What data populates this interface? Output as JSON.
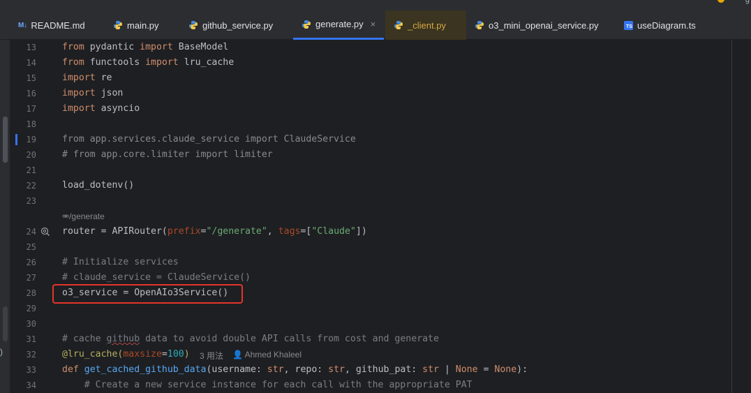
{
  "top_badge": "g",
  "tabs": [
    {
      "label": "README.md",
      "icon": "markdown-icon",
      "active": false
    },
    {
      "label": "main.py",
      "icon": "python-icon",
      "active": false
    },
    {
      "label": "github_service.py",
      "icon": "python-icon",
      "active": false
    },
    {
      "label": "generate.py",
      "icon": "python-icon",
      "active": true
    },
    {
      "label": "_client.py",
      "icon": "python-icon",
      "active": false
    },
    {
      "label": "o3_mini_openai_service.py",
      "icon": "python-icon",
      "active": false
    },
    {
      "label": "useDiagram.ts",
      "icon": "typescript-icon",
      "active": false
    }
  ],
  "close_glyph": "×",
  "left_glyph": ")",
  "line_numbers": [
    "13",
    "14",
    "15",
    "16",
    "17",
    "18",
    "19",
    "20",
    "21",
    "22",
    "23",
    "24",
    "25",
    "26",
    "27",
    "28",
    "29",
    "30",
    "31",
    "32",
    "33",
    "34"
  ],
  "code": {
    "l13": {
      "kw1": "from",
      "mod": " pydantic ",
      "kw2": "import",
      "name": " BaseModel"
    },
    "l14": {
      "kw1": "from",
      "mod": " functools ",
      "kw2": "import",
      "name": " lru_cache"
    },
    "l15": {
      "kw": "import",
      "name": " re"
    },
    "l16": {
      "kw": "import",
      "name": " json"
    },
    "l17": {
      "kw": "import",
      "name": " asyncio"
    },
    "l19": "from app.services.claude_service import ClaudeService",
    "l20": "# from app.core.limiter import limiter",
    "l22": "load_dotenv()",
    "route_hint": "/generate",
    "l24": {
      "a": "router = APIRouter(",
      "p1": "prefix",
      "eq1": "=",
      "s1": "\"/generate\"",
      "comma": ", ",
      "p2": "tags",
      "eq2": "=[",
      "s2": "\"Claude\"",
      "end": "])"
    },
    "l26": "# Initialize services",
    "l27": "# claude_service = ClaudeService()",
    "l28": "o3_service = OpenAIo3Service()",
    "l31a": "# cache ",
    "l31b": "github",
    "l31c": " data to avoid double API calls from cost and generate",
    "l32": {
      "dec": "@lru_cache(",
      "p": "maxsize",
      "eq": "=",
      "num": "100",
      "end": ")"
    },
    "usage_hint": "3 用法",
    "author_hint": "Ahmed Khaleel",
    "l33": {
      "kw": "def",
      "fn": " get_cached_github_data",
      "a": "(username: ",
      "t1": "str",
      "b": ", repo: ",
      "t2": "str",
      "c": ", github_pat: ",
      "t3": "str",
      "d": " | ",
      "n1": "None",
      "e": " = ",
      "n2": "None",
      "f": "):"
    },
    "l34": "    # Create a new service instance for each call with the appropriate PAT"
  },
  "colors": {
    "keyword": "#cf8e6d",
    "string": "#6aab73",
    "comment": "#7a7e85",
    "function": "#56a8f5",
    "decorator": "#b3ae60",
    "number": "#2aacb8",
    "accent": "#3574f0",
    "highlight_box": "#e5342a"
  }
}
